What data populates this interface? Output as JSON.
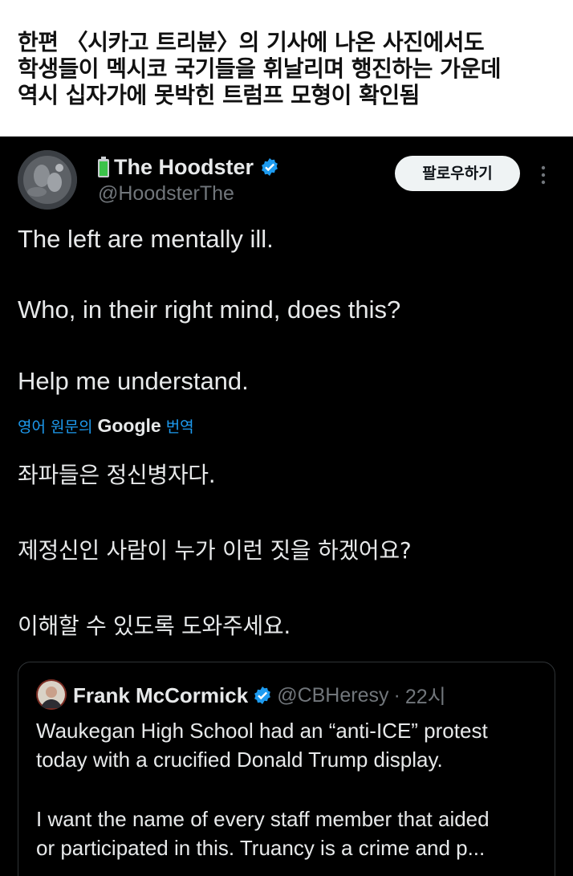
{
  "caption": {
    "lines": [
      "한편 〈시카고 트리뷴〉의 기사에 나온 사진에서도",
      "학생들이 멕시코 국기들을 휘날리며 행진하는 가운데",
      "역시 십자가에 못박힌 트럼프 모형이 확인됨"
    ]
  },
  "post": {
    "author": {
      "display_name": "The Hoodster",
      "handle": "@HoodsterThe",
      "emoji_icon": "battery-icon",
      "verified_icon": "verified-badge-icon",
      "verified_color": "#1d9bf0"
    },
    "follow_button": "팔로우하기",
    "more_icon": "more-vertical-icon",
    "text_lines": [
      "The left are mentally ill.",
      "Who, in their right mind, does this?",
      "Help me understand."
    ],
    "translation": {
      "prefix": "영어 원문의",
      "provider": "Google",
      "suffix": "번역",
      "lines": [
        "좌파들은 정신병자다.",
        "제정신인 사람이 누가 이런 짓을 하겠어요?",
        "이해할 수 있도록 도와주세요."
      ]
    },
    "quote": {
      "display_name": "Frank McCormick",
      "handle": "@CBHeresy",
      "separator": "·",
      "time": "22시",
      "text_lines": [
        "Waukegan High School had an “anti-ICE” protest",
        "today with a crucified Donald Trump display.",
        "I want the name of every staff member that aided",
        "or participated in this. Truancy is a crime and p..."
      ]
    }
  },
  "colors": {
    "background": "#000000",
    "text": "#e7e9ea",
    "secondary_text": "#71767b",
    "accent": "#1d9bf0",
    "follow_button_bg": "#eff3f4"
  }
}
